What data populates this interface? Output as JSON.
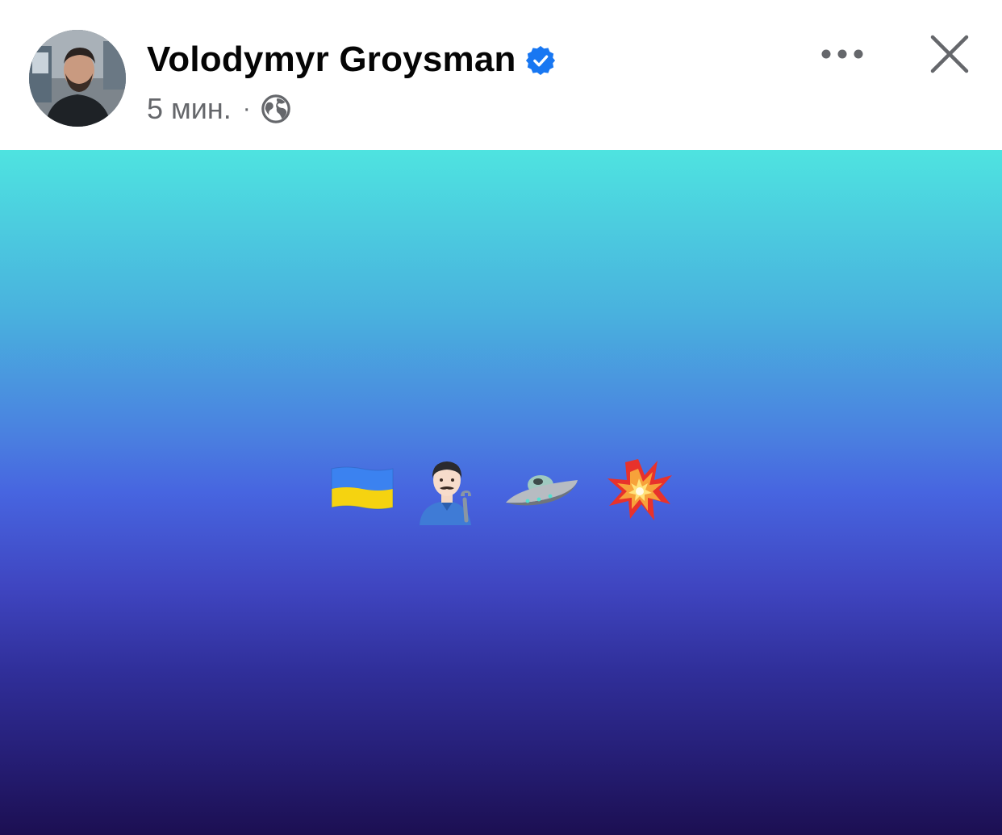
{
  "post": {
    "author_name": "Volodymyr Groysman",
    "verified": true,
    "timestamp": "5 мин.",
    "separator": "·",
    "privacy_icon": "globe-icon",
    "menu_icon": "more-horizontal-icon",
    "close_icon": "close-icon"
  },
  "content": {
    "background_gradient": [
      "#4ee3e0",
      "#4765e0",
      "#1c0f52"
    ],
    "emojis": [
      "ukraine-flag",
      "man-mechanic",
      "flying-saucer",
      "collision"
    ]
  },
  "colors": {
    "name": "#050505",
    "meta": "#65676b",
    "verified": "#1877f2"
  }
}
